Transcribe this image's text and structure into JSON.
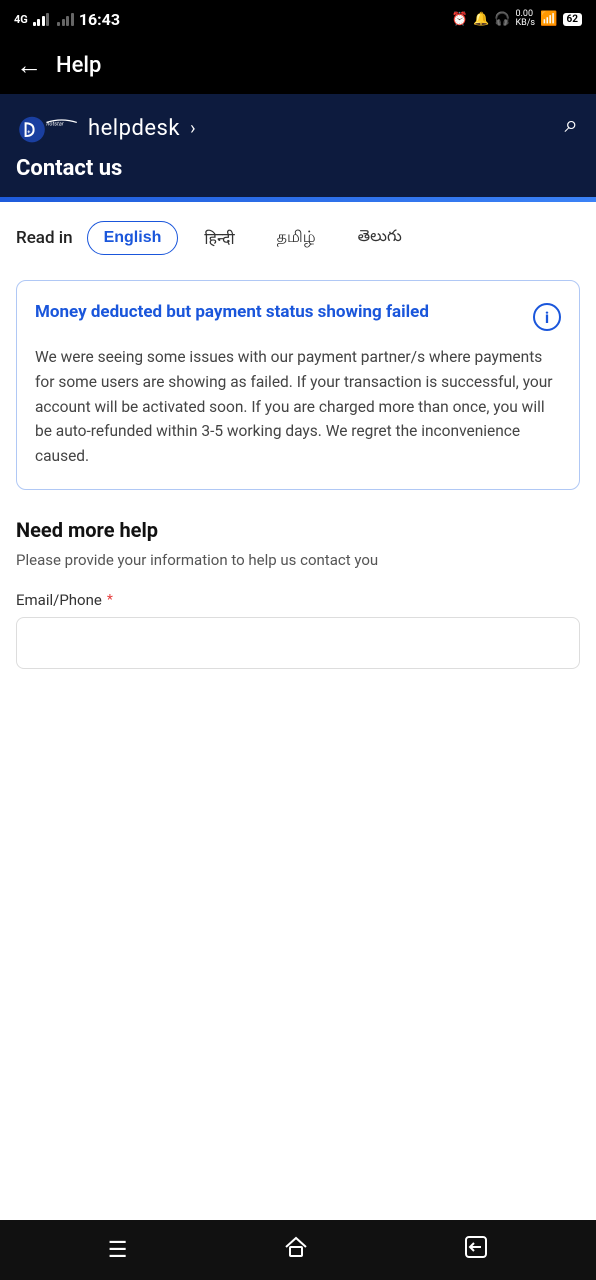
{
  "statusBar": {
    "carrier": "4G",
    "time": "16:43",
    "icons": [
      "alarm",
      "notification",
      "headphone",
      "data",
      "wifi",
      "battery"
    ],
    "battery": "62"
  },
  "topNav": {
    "backLabel": "←",
    "title": "Help"
  },
  "header": {
    "brandName": "Disney+ Hotstar",
    "helpdeskLabel": "helpdesk",
    "chevron": "›",
    "contactUs": "Contact us"
  },
  "languageBar": {
    "readInLabel": "Read in",
    "languages": [
      {
        "code": "en",
        "label": "English",
        "active": true
      },
      {
        "code": "hi",
        "label": "हिन्दी",
        "active": false
      },
      {
        "code": "ta",
        "label": "தமிழ்",
        "active": false
      },
      {
        "code": "te",
        "label": "తెలుగు",
        "active": false
      }
    ]
  },
  "infoCard": {
    "title": "Money deducted but payment status showing failed",
    "infoIconLabel": "i",
    "body": "We were seeing some issues with our payment partner/s where payments for some users are showing as failed. If your transaction is successful, your account will be activated soon. If you are charged more than once, you will be auto-refunded within 3-5 working days. We regret the inconvenience caused."
  },
  "needMoreHelp": {
    "title": "Need more help",
    "subtitle": "Please provide your information to help us contact you",
    "emailPhoneLabel": "Email/Phone",
    "requiredStar": "*",
    "inputPlaceholder": ""
  },
  "bottomNav": {
    "menuIcon": "☰",
    "homeIcon": "⌂",
    "backIcon": "⬛"
  }
}
